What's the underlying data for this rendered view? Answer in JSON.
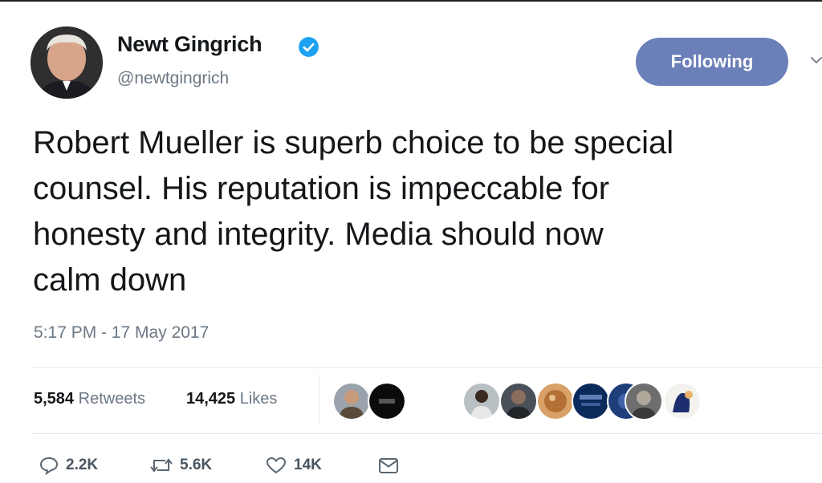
{
  "tweet": {
    "author": {
      "name": "Newt Gingrich",
      "handle": "@newtgingrich",
      "avatar_icon": "profile-photo"
    },
    "follow_button_label": "Following",
    "text": "Robert Mueller is superb choice to be special\ncounsel. His reputation is impeccable for\nhonesty and integrity. Media should now\ncalm down",
    "timestamp": "5:17 PM - 17 May 2017",
    "stats": {
      "retweets_count": "5,584",
      "retweets_label": "Retweets",
      "likes_count": "14,425",
      "likes_label": "Likes"
    },
    "liker_avatar_count": 9,
    "actions": {
      "reply_count": "2.2K",
      "retweet_count": "5.6K",
      "like_count": "14K"
    }
  },
  "colors": {
    "follow_button": "#6b7fb9",
    "verified": "#1da1f2",
    "secondary_text": "#6b7784"
  }
}
